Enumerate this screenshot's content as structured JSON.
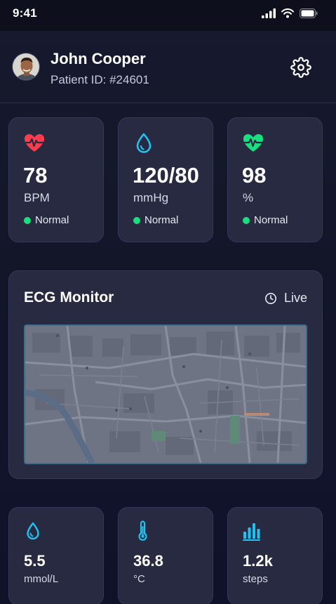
{
  "status_bar": {
    "time": "9:41"
  },
  "user": {
    "name": "John Cooper",
    "patient_id": "Patient ID: #24601"
  },
  "vitals": [
    {
      "value": "78",
      "unit": "BPM",
      "status": "Normal",
      "icon": "heart-pulse-icon",
      "icon_color": "#ff3b4e"
    },
    {
      "value": "120/80",
      "unit": "mmHg",
      "status": "Normal",
      "icon": "droplet-icon",
      "icon_color": "#1fc3f2"
    },
    {
      "value": "98",
      "unit": "%",
      "status": "Normal",
      "icon": "heart-pulse-icon",
      "icon_color": "#19e07f"
    }
  ],
  "ecg": {
    "title": "ECG Monitor",
    "live_label": "Live"
  },
  "metrics": [
    {
      "value": "5.5",
      "unit": "mmol/L",
      "icon": "droplet-icon"
    },
    {
      "value": "36.8",
      "unit": "°C",
      "icon": "thermometer-icon"
    },
    {
      "value": "1.2k",
      "unit": "steps",
      "icon": "bar-chart-icon"
    }
  ],
  "colors": {
    "accent_cyan": "#1fc3f2",
    "status_normal": "#19e07f",
    "heart_red": "#ff3b4e",
    "card_bg": "#272a41"
  }
}
